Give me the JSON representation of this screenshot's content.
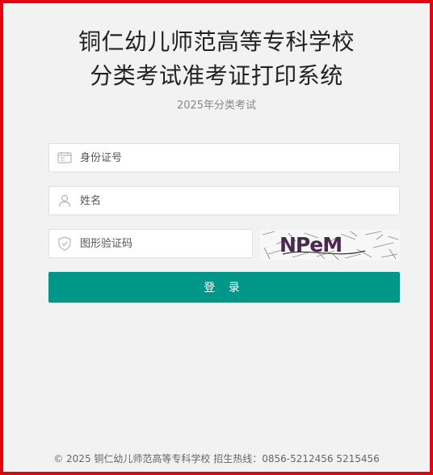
{
  "header": {
    "title_line1": "铜仁幼儿师范高等专科学校",
    "title_line2": "分类考试准考证打印系统",
    "subtitle": "2025年分类考试"
  },
  "form": {
    "id_card": {
      "placeholder": "身份证号",
      "icon": "id-card-icon"
    },
    "name": {
      "placeholder": "姓名",
      "icon": "user-icon"
    },
    "captcha": {
      "placeholder": "图形验证码",
      "icon": "shield-icon",
      "image_text": "NPeM"
    },
    "login_label": "登 录"
  },
  "footer": {
    "text": "© 2025  铜仁幼儿师范高等专科学校 招生热线：0856-5212456 5215456"
  },
  "colors": {
    "frame_border": "#e60012",
    "page_bg": "#f2f2f2",
    "button_bg": "#009688",
    "button_text": "#ffffff"
  }
}
